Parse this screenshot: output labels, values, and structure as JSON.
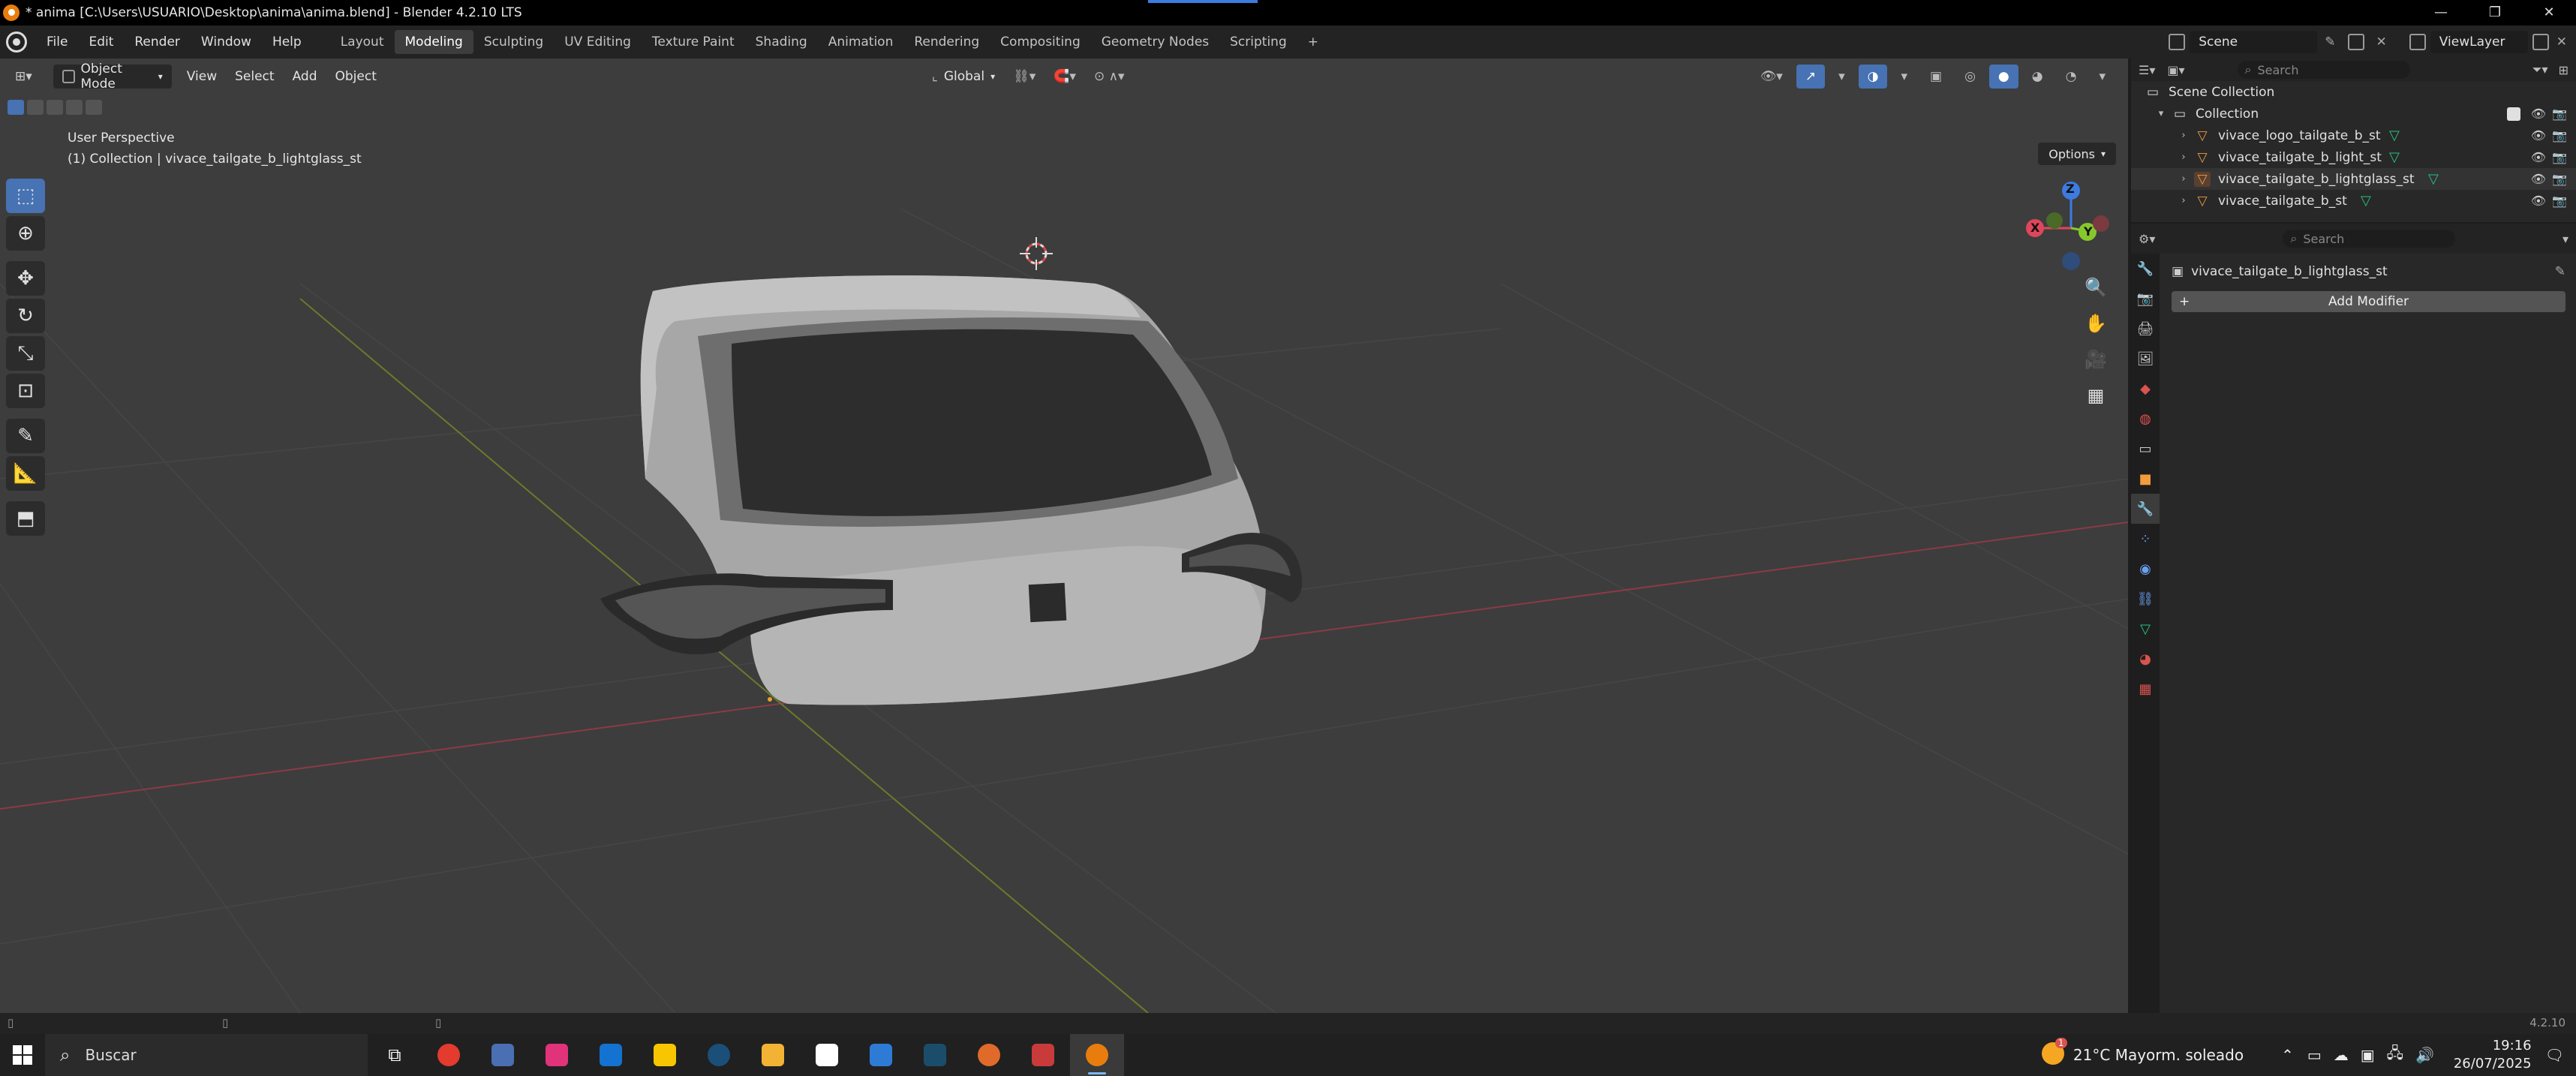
{
  "window": {
    "title": "* anima [C:\\Users\\USUARIO\\Desktop\\anima\\anima.blend] - Blender 4.2.10 LTS",
    "min": "—",
    "max": "❐",
    "close": "✕"
  },
  "menu": [
    "File",
    "Edit",
    "Render",
    "Window",
    "Help"
  ],
  "workspaces": [
    "Layout",
    "Modeling",
    "Sculpting",
    "UV Editing",
    "Texture Paint",
    "Shading",
    "Animation",
    "Rendering",
    "Compositing",
    "Geometry Nodes",
    "Scripting"
  ],
  "active_workspace": "Modeling",
  "add_workspace": "+",
  "scene": {
    "label": "Scene",
    "view_layer": "ViewLayer"
  },
  "viewport": {
    "mode": "Object Mode",
    "menus": [
      "View",
      "Select",
      "Add",
      "Object"
    ],
    "orientation": "Global",
    "options": "Options",
    "info_line1": "User Perspective",
    "info_line2": "(1) Collection | vivace_tailgate_b_lightglass_st",
    "gizmo": {
      "z": "Z",
      "y": "Y",
      "x": "X"
    }
  },
  "outliner": {
    "search_placeholder": "Search",
    "scene_collection": "Scene Collection",
    "collection": "Collection",
    "items": [
      {
        "name": "vivace_logo_tailgate_b_st"
      },
      {
        "name": "vivace_tailgate_b_light_st"
      },
      {
        "name": "vivace_tailgate_b_lightglass_st"
      },
      {
        "name": "vivace_tailgate_b_st"
      }
    ]
  },
  "properties": {
    "search_placeholder": "Search",
    "object_name": "vivace_tailgate_b_lightglass_st",
    "add_modifier": "Add Modifier"
  },
  "status": {
    "version": "4.2.10"
  },
  "taskbar": {
    "search": "Buscar",
    "weather": "21°C  Mayorm. soleado",
    "weather_badge": "1",
    "time": "19:16",
    "date": "26/07/2025"
  },
  "colors": {
    "accent": "#4772b3",
    "x_axis": "#e0465b",
    "y_axis": "#86c82c",
    "z_axis": "#3d7be0",
    "mesh_icon": "#25c47f",
    "object_icon": "#f39c3d"
  }
}
